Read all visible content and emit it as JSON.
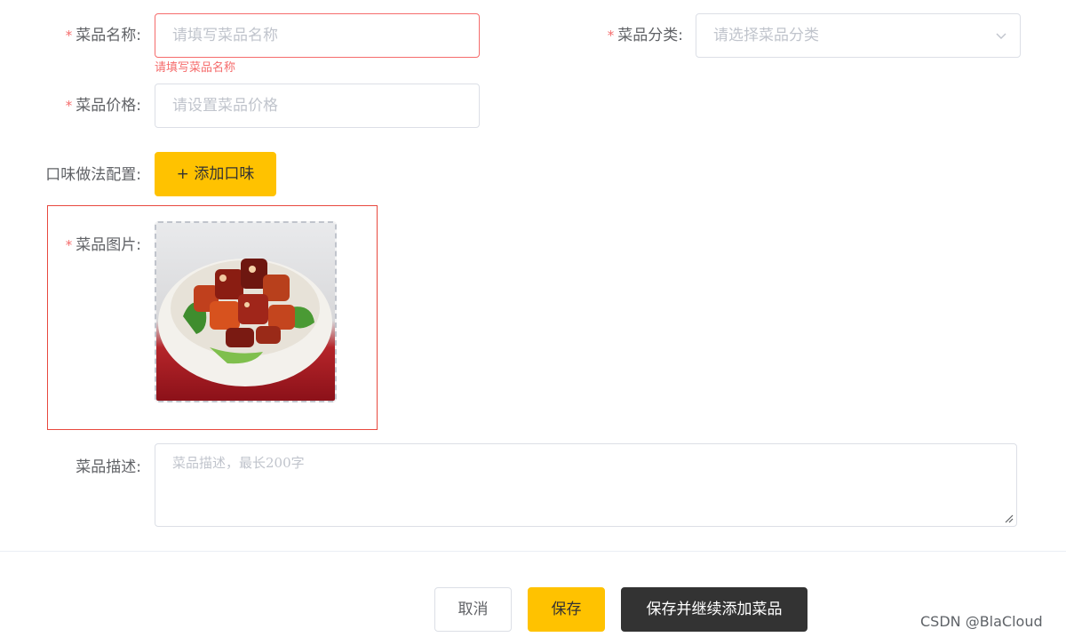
{
  "form": {
    "name": {
      "required_mark": "*",
      "label": "菜品名称:",
      "placeholder": "请填写菜品名称",
      "error": "请填写菜品名称"
    },
    "category": {
      "required_mark": "*",
      "label": "菜品分类:",
      "placeholder": "请选择菜品分类",
      "icon": "chevron-down-icon"
    },
    "price": {
      "required_mark": "*",
      "label": "菜品价格:",
      "placeholder": "请设置菜品价格"
    },
    "flavor": {
      "label": "口味做法配置:",
      "add_button": "+ 添加口味"
    },
    "image": {
      "required_mark": "*",
      "label": "菜品图片:"
    },
    "description": {
      "label": "菜品描述:",
      "placeholder": "菜品描述，最长200字"
    }
  },
  "footer": {
    "cancel": "取消",
    "save": "保存",
    "save_continue": "保存并继续添加菜品"
  },
  "watermark": "CSDN @BlaCloud",
  "colors": {
    "accent": "#ffc200",
    "error": "#f56c6c",
    "dark_button": "#333333",
    "highlight_border": "#e8483e"
  }
}
